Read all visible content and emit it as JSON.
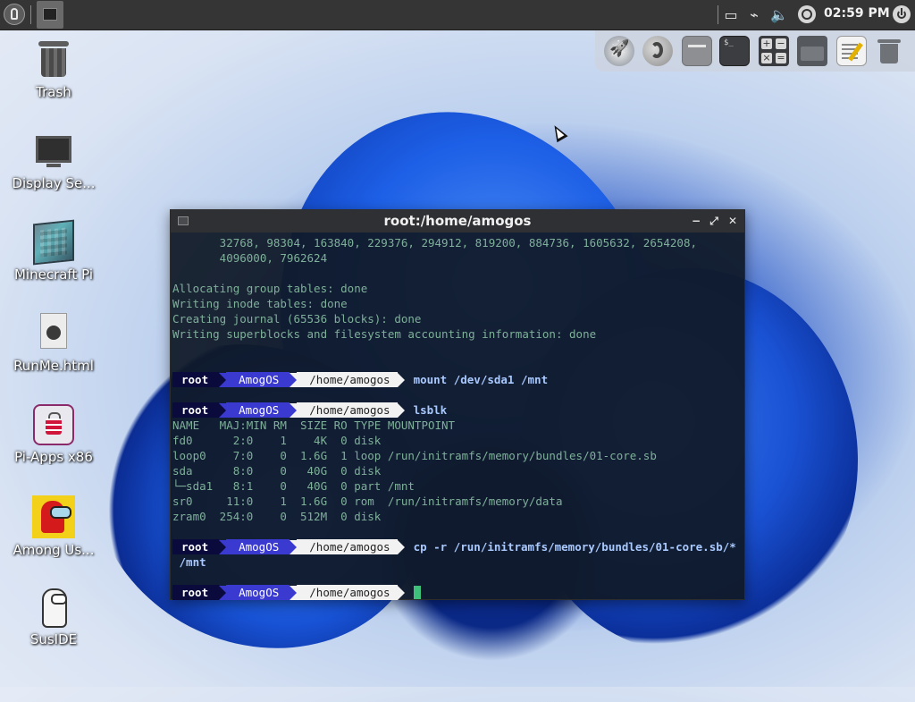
{
  "panel": {
    "clock": "02:59 PM",
    "tray_icons": [
      "screen-icon",
      "paperclip-icon",
      "volume-icon"
    ]
  },
  "dock": {
    "items": [
      "rocket-launcher",
      "firefox",
      "window-manager",
      "terminal",
      "calculator",
      "file-manager",
      "text-editor",
      "trash"
    ]
  },
  "desktop": {
    "icons": [
      {
        "label": "Trash"
      },
      {
        "label": "Display Se..."
      },
      {
        "label": "Minecraft Pi"
      },
      {
        "label": "RunMe.html"
      },
      {
        "label": "Pi-Apps x86"
      },
      {
        "label": "Among Us..."
      },
      {
        "label": "SusIDE"
      }
    ]
  },
  "terminal": {
    "title": "root:/home/amogos",
    "lines": [
      "       32768, 98304, 163840, 229376, 294912, 819200, 884736, 1605632, 2654208,",
      "       4096000, 7962624",
      "",
      "Allocating group tables: done",
      "Writing inode tables: done",
      "Creating journal (65536 blocks): done",
      "Writing superblocks and filesystem accounting information: done"
    ],
    "prompt": {
      "user": "root",
      "host": "AmogOS",
      "path": "/home/amogos"
    },
    "cmd1": "mount /dev/sda1 /mnt",
    "cmd2": "lsblk",
    "lsblk": [
      "NAME   MAJ:MIN RM  SIZE RO TYPE MOUNTPOINT",
      "fd0      2:0    1    4K  0 disk",
      "loop0    7:0    0  1.6G  1 loop /run/initramfs/memory/bundles/01-core.sb",
      "sda      8:0    0   40G  0 disk",
      "└─sda1   8:1    0   40G  0 part /mnt",
      "sr0     11:0    1  1.6G  0 rom  /run/initramfs/memory/data",
      "zram0  254:0    0  512M  0 disk"
    ],
    "cmd3": "cp -r /run/initramfs/memory/bundles/01-core.sb/*",
    "cmd3_cont": " /mnt"
  },
  "colors": {
    "prompt_user_bg": "#0a0a3c",
    "prompt_host_bg": "#3a3ad0",
    "prompt_path_bg": "#f2f2f2",
    "output_text": "#7fb09a",
    "command_text": "#a9c9ff",
    "cursor": "#3ec07a"
  }
}
